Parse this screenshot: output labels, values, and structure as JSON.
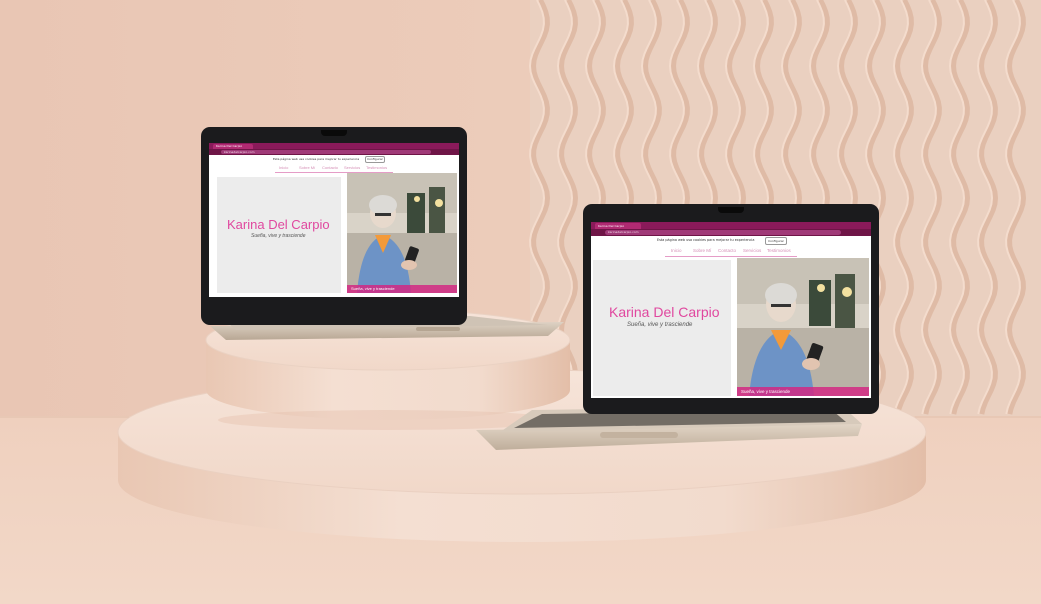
{
  "scene": {
    "colors": {
      "wall": "#e8c9b7",
      "floor": "#efcfbd",
      "pedestal": "#f3dccd",
      "laptop_bezel": "#1b1b1d",
      "laptop_body": "#cdbfae",
      "brand_pink": "#e0489f",
      "browser_chrome": "#8a1a5a"
    }
  },
  "website": {
    "tab_title": "Karina Del Carpio",
    "url": "karinadelcarpio.com",
    "cookie_notice": "Esta página web usa cookies para mejorar tu experiencia",
    "cookie_button": "Configurar",
    "nav_items": [
      "Inicio",
      "Sobre Mí",
      "Contacto",
      "Servicios",
      "Testimonios"
    ],
    "hero_title": "Karina Del Carpio",
    "hero_subtitle": "Sueña, vive y trasciende",
    "photo_caption": "Sueña, vive y trasciende"
  },
  "laptops": [
    {
      "name": "back-left",
      "icon": "laptop-icon"
    },
    {
      "name": "front-right",
      "icon": "laptop-icon"
    }
  ]
}
